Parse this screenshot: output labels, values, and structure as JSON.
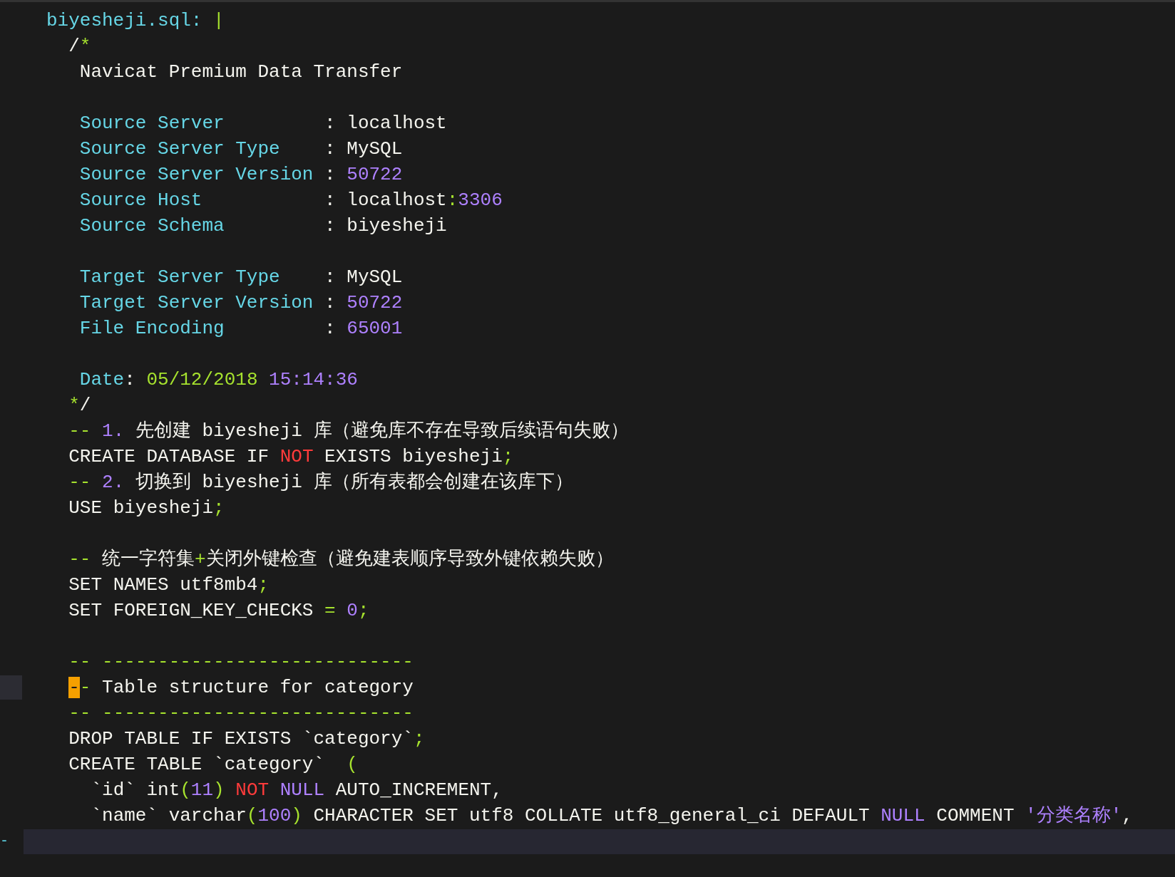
{
  "lines": [
    {
      "kind": "code",
      "tokens": [
        {
          "t": "biyesheji.sql:",
          "kind": "key"
        },
        {
          "t": " |",
          "kind": "punct"
        }
      ]
    },
    {
      "kind": "code",
      "tokens": [
        {
          "t": "  /",
          "kind": "plain"
        },
        {
          "t": "*",
          "kind": "punct"
        }
      ]
    },
    {
      "kind": "code",
      "tokens": [
        {
          "t": "   Navicat Premium Data Transfer",
          "kind": "plain"
        }
      ]
    },
    {
      "kind": "blank"
    },
    {
      "kind": "code",
      "tokens": [
        {
          "t": "   Source Server",
          "kind": "key"
        },
        {
          "t": "         : localhost",
          "kind": "plain"
        }
      ]
    },
    {
      "kind": "code",
      "tokens": [
        {
          "t": "   Source Server Type",
          "kind": "key"
        },
        {
          "t": "    : MySQL",
          "kind": "plain"
        }
      ]
    },
    {
      "kind": "code",
      "tokens": [
        {
          "t": "   Source Server Version",
          "kind": "key"
        },
        {
          "t": " :",
          "kind": "plain"
        },
        {
          "t": " 50722",
          "kind": "number"
        }
      ]
    },
    {
      "kind": "code",
      "tokens": [
        {
          "t": "   Source Host",
          "kind": "key"
        },
        {
          "t": "           : localhost",
          "kind": "plain"
        },
        {
          "t": ":",
          "kind": "punct"
        },
        {
          "t": "3306",
          "kind": "number"
        }
      ]
    },
    {
      "kind": "code",
      "tokens": [
        {
          "t": "   Source Schema",
          "kind": "key"
        },
        {
          "t": "         : biyesheji",
          "kind": "plain"
        }
      ]
    },
    {
      "kind": "blank"
    },
    {
      "kind": "code",
      "tokens": [
        {
          "t": "   Target Server Type",
          "kind": "key"
        },
        {
          "t": "    : MySQL",
          "kind": "plain"
        }
      ]
    },
    {
      "kind": "code",
      "tokens": [
        {
          "t": "   Target Server Version",
          "kind": "key"
        },
        {
          "t": " :",
          "kind": "plain"
        },
        {
          "t": " 50722",
          "kind": "number"
        }
      ]
    },
    {
      "kind": "code",
      "tokens": [
        {
          "t": "   File Encoding",
          "kind": "key"
        },
        {
          "t": "         :",
          "kind": "plain"
        },
        {
          "t": " 65001",
          "kind": "number"
        }
      ]
    },
    {
      "kind": "blank"
    },
    {
      "kind": "code",
      "tokens": [
        {
          "t": "   Date",
          "kind": "key"
        },
        {
          "t": ":",
          "kind": "plain"
        },
        {
          "t": " 05/12/2018",
          "kind": "punct"
        },
        {
          "t": " 15:14:36",
          "kind": "number"
        }
      ]
    },
    {
      "kind": "code",
      "tokens": [
        {
          "t": "  *",
          "kind": "punct"
        },
        {
          "t": "/",
          "kind": "plain"
        }
      ]
    },
    {
      "kind": "code",
      "tokens": [
        {
          "t": "  --",
          "kind": "punct"
        },
        {
          "t": " 1.",
          "kind": "number"
        },
        {
          "t": " 先创建 biyesheji 库（避免库不存在导致后续语句失败）",
          "kind": "plain"
        }
      ]
    },
    {
      "kind": "code",
      "tokens": [
        {
          "t": "  CREATE DATABASE IF",
          "kind": "plain"
        },
        {
          "t": " NOT",
          "kind": "keyword"
        },
        {
          "t": " EXISTS biyesheji",
          "kind": "plain"
        },
        {
          "t": ";",
          "kind": "punct"
        }
      ]
    },
    {
      "kind": "code",
      "tokens": [
        {
          "t": "  --",
          "kind": "punct"
        },
        {
          "t": " 2.",
          "kind": "number"
        },
        {
          "t": " 切换到 biyesheji 库（所有表都会创建在该库下）",
          "kind": "plain"
        }
      ]
    },
    {
      "kind": "code",
      "tokens": [
        {
          "t": "  USE biyesheji",
          "kind": "plain"
        },
        {
          "t": ";",
          "kind": "punct"
        }
      ]
    },
    {
      "kind": "blank"
    },
    {
      "kind": "code",
      "tokens": [
        {
          "t": "  --",
          "kind": "punct"
        },
        {
          "t": " 统一字符集",
          "kind": "plain"
        },
        {
          "t": "+",
          "kind": "punct"
        },
        {
          "t": "关闭外键检查（避免建表顺序导致外键依赖失败）",
          "kind": "plain"
        }
      ]
    },
    {
      "kind": "code",
      "tokens": [
        {
          "t": "  SET NAMES utf8mb4",
          "kind": "plain"
        },
        {
          "t": ";",
          "kind": "punct"
        }
      ]
    },
    {
      "kind": "code",
      "tokens": [
        {
          "t": "  SET FOREIGN_KEY_CHECKS",
          "kind": "plain"
        },
        {
          "t": " =",
          "kind": "punct"
        },
        {
          "t": " 0",
          "kind": "number"
        },
        {
          "t": ";",
          "kind": "punct"
        }
      ]
    },
    {
      "kind": "blank"
    },
    {
      "kind": "code",
      "tokens": [
        {
          "t": "  -- ----------------------------",
          "kind": "punct"
        }
      ]
    },
    {
      "kind": "marked",
      "tokens": [
        {
          "t": "  -",
          "kind": "cursor"
        },
        {
          "t": "-",
          "kind": "punct"
        },
        {
          "t": " Table structure for category",
          "kind": "plain"
        }
      ]
    },
    {
      "kind": "code",
      "tokens": [
        {
          "t": "  -- ----------------------------",
          "kind": "punct"
        }
      ]
    },
    {
      "kind": "code",
      "tokens": [
        {
          "t": "  DROP TABLE IF EXISTS `category`",
          "kind": "plain"
        },
        {
          "t": ";",
          "kind": "punct"
        }
      ]
    },
    {
      "kind": "code",
      "tokens": [
        {
          "t": "  CREATE TABLE `category`",
          "kind": "plain"
        },
        {
          "t": "  (",
          "kind": "punct"
        }
      ]
    },
    {
      "kind": "code",
      "tokens": [
        {
          "t": "    `id` int",
          "kind": "plain"
        },
        {
          "t": "(",
          "kind": "punct"
        },
        {
          "t": "11",
          "kind": "number"
        },
        {
          "t": ")",
          "kind": "punct"
        },
        {
          "t": " NOT",
          "kind": "keyword"
        },
        {
          "t": " NULL",
          "kind": "number"
        },
        {
          "t": " AUTO_INCREMENT,",
          "kind": "plain"
        }
      ]
    },
    {
      "kind": "code",
      "tokens": [
        {
          "t": "    `name` varchar",
          "kind": "plain"
        },
        {
          "t": "(",
          "kind": "punct"
        },
        {
          "t": "100",
          "kind": "number"
        },
        {
          "t": ")",
          "kind": "punct"
        },
        {
          "t": " CHARACTER SET utf8 COLLATE utf8_general_ci DEFAULT",
          "kind": "plain"
        },
        {
          "t": " NULL",
          "kind": "number"
        },
        {
          "t": " COMMENT",
          "kind": "plain"
        },
        {
          "t": " '分类名称'",
          "kind": "number"
        },
        {
          "t": ",",
          "kind": "plain"
        }
      ]
    },
    {
      "kind": "current",
      "gutter": "-"
    }
  ]
}
